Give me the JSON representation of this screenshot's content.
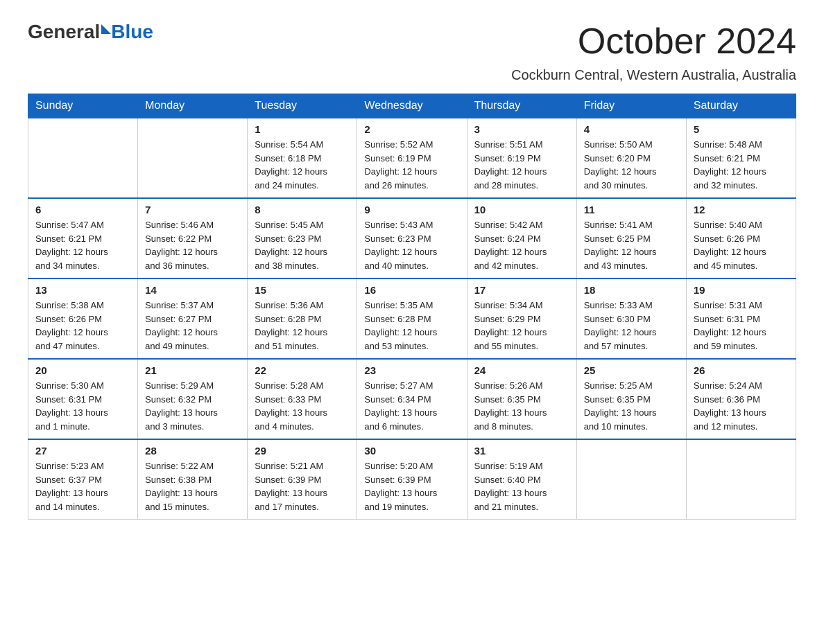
{
  "logo": {
    "general": "General",
    "triangle": "▶",
    "blue": "Blue"
  },
  "title": "October 2024",
  "location": "Cockburn Central, Western Australia, Australia",
  "days_of_week": [
    "Sunday",
    "Monday",
    "Tuesday",
    "Wednesday",
    "Thursday",
    "Friday",
    "Saturday"
  ],
  "weeks": [
    [
      {
        "day": "",
        "info": ""
      },
      {
        "day": "",
        "info": ""
      },
      {
        "day": "1",
        "info": "Sunrise: 5:54 AM\nSunset: 6:18 PM\nDaylight: 12 hours\nand 24 minutes."
      },
      {
        "day": "2",
        "info": "Sunrise: 5:52 AM\nSunset: 6:19 PM\nDaylight: 12 hours\nand 26 minutes."
      },
      {
        "day": "3",
        "info": "Sunrise: 5:51 AM\nSunset: 6:19 PM\nDaylight: 12 hours\nand 28 minutes."
      },
      {
        "day": "4",
        "info": "Sunrise: 5:50 AM\nSunset: 6:20 PM\nDaylight: 12 hours\nand 30 minutes."
      },
      {
        "day": "5",
        "info": "Sunrise: 5:48 AM\nSunset: 6:21 PM\nDaylight: 12 hours\nand 32 minutes."
      }
    ],
    [
      {
        "day": "6",
        "info": "Sunrise: 5:47 AM\nSunset: 6:21 PM\nDaylight: 12 hours\nand 34 minutes."
      },
      {
        "day": "7",
        "info": "Sunrise: 5:46 AM\nSunset: 6:22 PM\nDaylight: 12 hours\nand 36 minutes."
      },
      {
        "day": "8",
        "info": "Sunrise: 5:45 AM\nSunset: 6:23 PM\nDaylight: 12 hours\nand 38 minutes."
      },
      {
        "day": "9",
        "info": "Sunrise: 5:43 AM\nSunset: 6:23 PM\nDaylight: 12 hours\nand 40 minutes."
      },
      {
        "day": "10",
        "info": "Sunrise: 5:42 AM\nSunset: 6:24 PM\nDaylight: 12 hours\nand 42 minutes."
      },
      {
        "day": "11",
        "info": "Sunrise: 5:41 AM\nSunset: 6:25 PM\nDaylight: 12 hours\nand 43 minutes."
      },
      {
        "day": "12",
        "info": "Sunrise: 5:40 AM\nSunset: 6:26 PM\nDaylight: 12 hours\nand 45 minutes."
      }
    ],
    [
      {
        "day": "13",
        "info": "Sunrise: 5:38 AM\nSunset: 6:26 PM\nDaylight: 12 hours\nand 47 minutes."
      },
      {
        "day": "14",
        "info": "Sunrise: 5:37 AM\nSunset: 6:27 PM\nDaylight: 12 hours\nand 49 minutes."
      },
      {
        "day": "15",
        "info": "Sunrise: 5:36 AM\nSunset: 6:28 PM\nDaylight: 12 hours\nand 51 minutes."
      },
      {
        "day": "16",
        "info": "Sunrise: 5:35 AM\nSunset: 6:28 PM\nDaylight: 12 hours\nand 53 minutes."
      },
      {
        "day": "17",
        "info": "Sunrise: 5:34 AM\nSunset: 6:29 PM\nDaylight: 12 hours\nand 55 minutes."
      },
      {
        "day": "18",
        "info": "Sunrise: 5:33 AM\nSunset: 6:30 PM\nDaylight: 12 hours\nand 57 minutes."
      },
      {
        "day": "19",
        "info": "Sunrise: 5:31 AM\nSunset: 6:31 PM\nDaylight: 12 hours\nand 59 minutes."
      }
    ],
    [
      {
        "day": "20",
        "info": "Sunrise: 5:30 AM\nSunset: 6:31 PM\nDaylight: 13 hours\nand 1 minute."
      },
      {
        "day": "21",
        "info": "Sunrise: 5:29 AM\nSunset: 6:32 PM\nDaylight: 13 hours\nand 3 minutes."
      },
      {
        "day": "22",
        "info": "Sunrise: 5:28 AM\nSunset: 6:33 PM\nDaylight: 13 hours\nand 4 minutes."
      },
      {
        "day": "23",
        "info": "Sunrise: 5:27 AM\nSunset: 6:34 PM\nDaylight: 13 hours\nand 6 minutes."
      },
      {
        "day": "24",
        "info": "Sunrise: 5:26 AM\nSunset: 6:35 PM\nDaylight: 13 hours\nand 8 minutes."
      },
      {
        "day": "25",
        "info": "Sunrise: 5:25 AM\nSunset: 6:35 PM\nDaylight: 13 hours\nand 10 minutes."
      },
      {
        "day": "26",
        "info": "Sunrise: 5:24 AM\nSunset: 6:36 PM\nDaylight: 13 hours\nand 12 minutes."
      }
    ],
    [
      {
        "day": "27",
        "info": "Sunrise: 5:23 AM\nSunset: 6:37 PM\nDaylight: 13 hours\nand 14 minutes."
      },
      {
        "day": "28",
        "info": "Sunrise: 5:22 AM\nSunset: 6:38 PM\nDaylight: 13 hours\nand 15 minutes."
      },
      {
        "day": "29",
        "info": "Sunrise: 5:21 AM\nSunset: 6:39 PM\nDaylight: 13 hours\nand 17 minutes."
      },
      {
        "day": "30",
        "info": "Sunrise: 5:20 AM\nSunset: 6:39 PM\nDaylight: 13 hours\nand 19 minutes."
      },
      {
        "day": "31",
        "info": "Sunrise: 5:19 AM\nSunset: 6:40 PM\nDaylight: 13 hours\nand 21 minutes."
      },
      {
        "day": "",
        "info": ""
      },
      {
        "day": "",
        "info": ""
      }
    ]
  ]
}
